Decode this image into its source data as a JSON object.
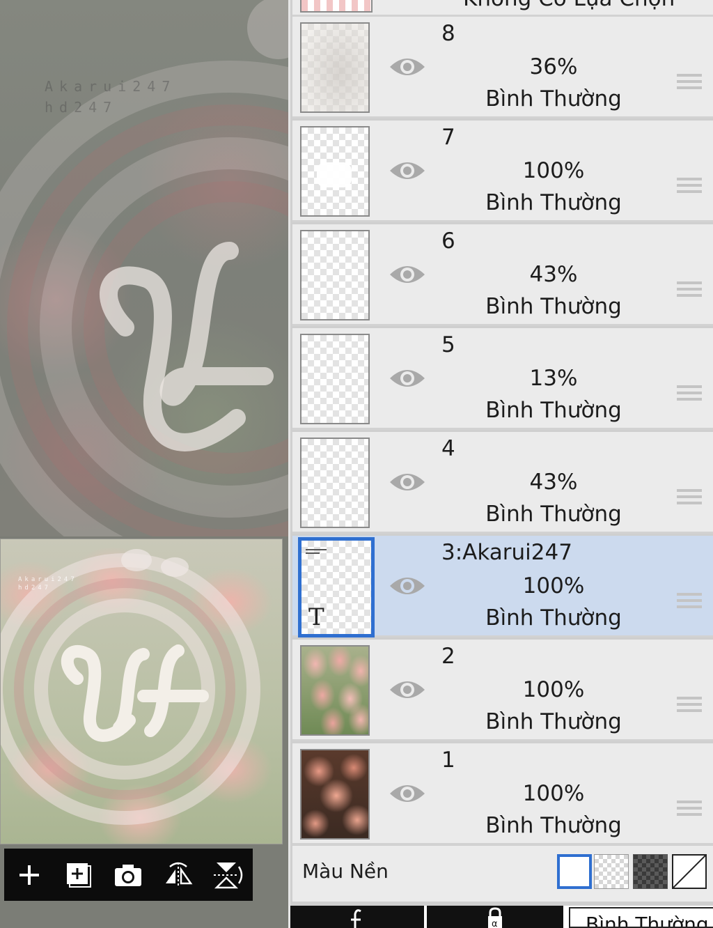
{
  "canvas": {
    "watermark_line1": "Akarui247",
    "watermark_line2": "hd247",
    "preview_line1": "Akarui247",
    "preview_line2": "hd247"
  },
  "toolbar": {
    "buttons": [
      {
        "name": "add-layer",
        "icon": "plus-icon"
      },
      {
        "name": "duplicate-layer",
        "icon": "add-layer-icon"
      },
      {
        "name": "camera",
        "icon": "camera-icon"
      },
      {
        "name": "flip-horizontal",
        "icon": "flip-horizontal-icon"
      },
      {
        "name": "flip-vertical",
        "icon": "flip-vertical-icon"
      }
    ]
  },
  "layers_panel": {
    "top_partial_text": "Không Có Lựa Chọn",
    "layers": [
      {
        "num": "8",
        "opacity": "36%",
        "mode": "Bình Thường",
        "thumb": "faded-texture",
        "selected": false
      },
      {
        "num": "7",
        "opacity": "100%",
        "mode": "Bình Thường",
        "thumb": "white-mark",
        "selected": false
      },
      {
        "num": "6",
        "opacity": "43%",
        "mode": "Bình Thường",
        "thumb": "transparent",
        "selected": false
      },
      {
        "num": "5",
        "opacity": "13%",
        "mode": "Bình Thường",
        "thumb": "transparent",
        "selected": false
      },
      {
        "num": "4",
        "opacity": "43%",
        "mode": "Bình Thường",
        "thumb": "transparent",
        "selected": false
      },
      {
        "num": "3:Akarui247",
        "opacity": "100%",
        "mode": "Bình Thường",
        "thumb": "text",
        "thumb_text": "T",
        "selected": true
      },
      {
        "num": "2",
        "opacity": "100%",
        "mode": "Bình Thường",
        "thumb": "pink-tulips",
        "selected": false
      },
      {
        "num": "1",
        "opacity": "100%",
        "mode": "Bình Thường",
        "thumb": "roses",
        "selected": false
      }
    ],
    "background_color_label": "Màu Nền",
    "background_swatches": [
      "white",
      "transparent",
      "dark-checker",
      "none"
    ],
    "selected_swatch": "white"
  },
  "bottom_bar": {
    "buttons": [
      {
        "name": "clipping",
        "icon": "clip-f-icon"
      },
      {
        "name": "lock",
        "icon": "lock-alpha-icon"
      }
    ],
    "blend_mode": "Bình Thường"
  },
  "colors": {
    "selection_accent": "#2f6fd0",
    "selected_row": "#ccdaee",
    "row_bg": "#ebebeb",
    "toolbar_bg": "#0c0c0c"
  }
}
